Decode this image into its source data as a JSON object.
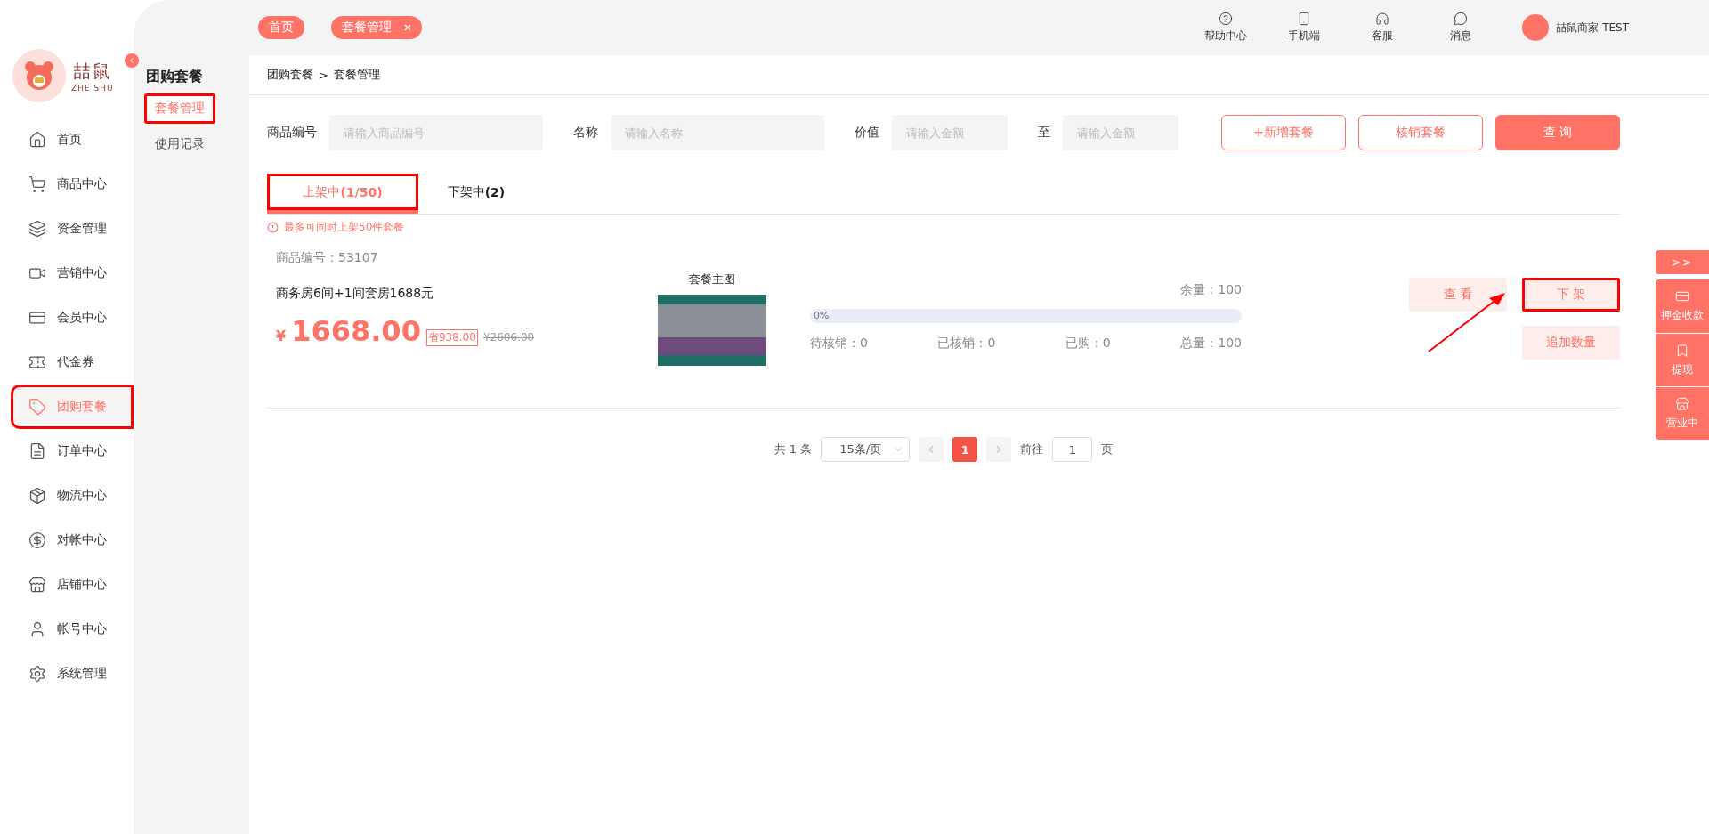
{
  "sidebar": {
    "logo": {
      "name": "喆鼠",
      "subtitle": "ZHE SHU"
    },
    "items": [
      {
        "label": "首页",
        "selected": false,
        "highlighted": false
      },
      {
        "label": "商品中心",
        "selected": false,
        "highlighted": false
      },
      {
        "label": "资金管理",
        "selected": false,
        "highlighted": false
      },
      {
        "label": "营销中心",
        "selected": false,
        "highlighted": false
      },
      {
        "label": "会员中心",
        "selected": false,
        "highlighted": false
      },
      {
        "label": "代金券",
        "selected": false,
        "highlighted": false
      },
      {
        "label": "团购套餐",
        "selected": true,
        "highlighted": true
      },
      {
        "label": "订单中心",
        "selected": false,
        "highlighted": false
      },
      {
        "label": "物流中心",
        "selected": false,
        "highlighted": false
      },
      {
        "label": "对帐中心",
        "selected": false,
        "highlighted": false
      },
      {
        "label": "店铺中心",
        "selected": false,
        "highlighted": false
      },
      {
        "label": "帐号中心",
        "selected": false,
        "highlighted": false
      },
      {
        "label": "系统管理",
        "selected": false,
        "highlighted": false
      }
    ]
  },
  "submenu": {
    "title": "团购套餐",
    "items": [
      {
        "label": "套餐管理",
        "selected": true,
        "highlighted": true
      },
      {
        "label": "使用记录",
        "selected": false,
        "highlighted": false
      }
    ]
  },
  "top_tabs": [
    {
      "label": "首页",
      "closable": false
    },
    {
      "label": "套餐管理",
      "closable": true
    }
  ],
  "toolbar": [
    "帮助中心",
    "手机端",
    "客服",
    "消息"
  ],
  "user": {
    "name": "喆鼠商家-TEST"
  },
  "breadcrumb": {
    "items": [
      "团购套餐",
      "套餐管理"
    ],
    "separator": ">"
  },
  "filters": [
    {
      "label": "商品编号",
      "placeholder": "请输入商品编号",
      "kind": "wide"
    },
    {
      "label": "名称",
      "placeholder": "请输入名称",
      "kind": "wide"
    },
    {
      "label": "价值",
      "placeholder": "请输入金额",
      "kind": "narrow"
    },
    {
      "label": "至",
      "placeholder": "请输入金额",
      "kind": "narrow"
    }
  ],
  "buttons": [
    {
      "label": "+新增套餐",
      "kind": "outline"
    },
    {
      "label": "核销套餐",
      "kind": "outline"
    },
    {
      "label": "查 询",
      "kind": "primary"
    }
  ],
  "tabs": [
    {
      "label": "上架中**(1/50)**",
      "selected": true,
      "highlighted": true
    },
    {
      "label": "下架中**(2)**",
      "selected": false,
      "highlighted": false
    }
  ],
  "notice": "最多可同时上架50件套餐",
  "products": [
    {
      "code": "商品编号：53107",
      "name": "商务房6间+1间套房1688元",
      "currency": "¥",
      "price": "1668.00",
      "saving": "省938.00",
      "original_price": "¥2606.00",
      "image_label": "套餐主图",
      "remaining": "余量：100",
      "level": 0,
      "progress_text": "0%",
      "stats": [
        "待核销：0",
        "已核销：0",
        "已购：0",
        "总量：100"
      ],
      "actions": [
        {
          "label": "查 看",
          "highlighted": false
        },
        {
          "label": "下 架",
          "highlighted": true
        },
        {
          "label": "追加数量",
          "highlighted": false
        }
      ]
    }
  ],
  "pagination": {
    "total": "共 1 条",
    "page_size": "15条/页",
    "pages": [
      {
        "label": "1",
        "selected": true
      }
    ],
    "goto_label": "前往",
    "goto_value": "1",
    "page_suffix": "页"
  },
  "dock": {
    "toggle": ">>",
    "items": [
      "押金收款",
      "提现",
      "营业中"
    ]
  }
}
